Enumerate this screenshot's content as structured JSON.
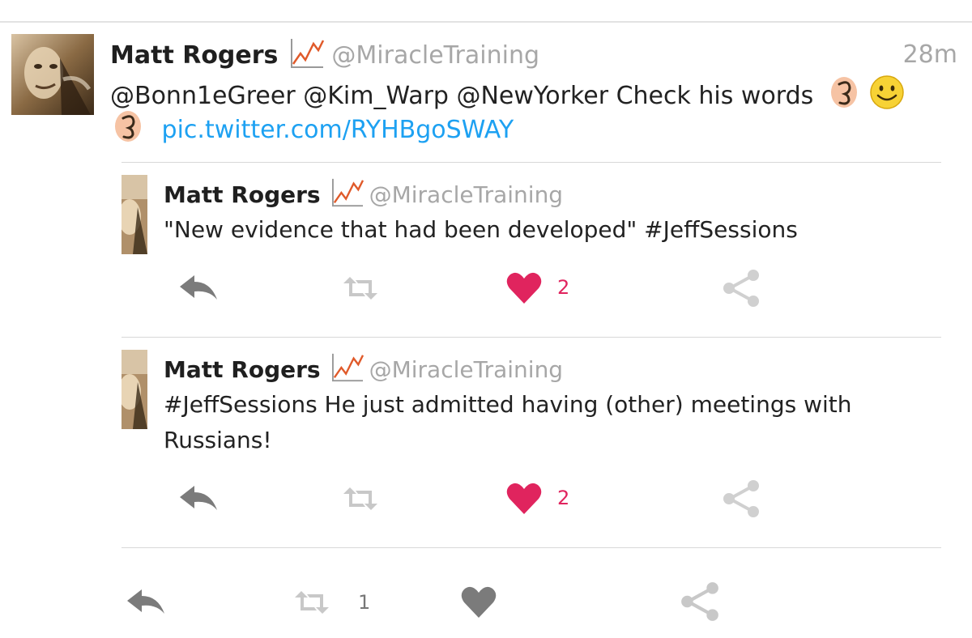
{
  "main_tweet": {
    "display_name": "Matt Rogers",
    "name_emoji": "chart-increasing-icon",
    "handle": "@MiracleTraining",
    "timestamp": "28m",
    "text_line1": "@Bonn1eGreer @Kim_Warp @NewYorker Check his words",
    "link": "pic.twitter.com/RYHBgoSWAY",
    "emojis": [
      "ear-icon",
      "smiley-icon",
      "ear-icon"
    ],
    "actions": {
      "retweet_count": "1"
    }
  },
  "quoted": [
    {
      "display_name": "Matt Rogers",
      "handle": "@MiracleTraining",
      "text_lines": [
        "\"New evidence that had been developed\" #JeffSessions"
      ],
      "like_count": "2"
    },
    {
      "display_name": "Matt Rogers",
      "handle": "@MiracleTraining",
      "text_lines": [
        "#JeffSessions He just admitted having (other) meetings with",
        "Russians!"
      ],
      "like_count": "2"
    }
  ],
  "colors": {
    "link": "#1da1f2",
    "like_active": "#e0245e",
    "handle_gray": "#a7a7a7"
  }
}
